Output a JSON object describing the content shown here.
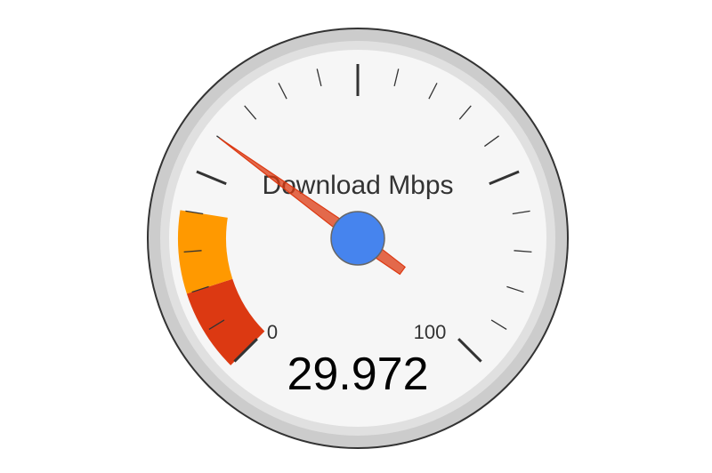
{
  "chart_data": {
    "type": "gauge",
    "title": "Download Mbps",
    "value": 29.972,
    "value_label": "29.972",
    "min": 0,
    "max": 100,
    "min_label": "0",
    "max_label": "100",
    "major_ticks": 5,
    "minor_ticks_per_major": 5,
    "bands": [
      {
        "from": 0,
        "to": 10,
        "color": "#dc3912"
      },
      {
        "from": 10,
        "to": 20,
        "color": "#ff9900"
      }
    ]
  },
  "colors": {
    "rim": "#cccccc",
    "rim_inner": "#e0e0e0",
    "face": "#f6f6f6",
    "needle": "#dc3912",
    "hub": "#4684ee",
    "tick": "#333333"
  }
}
